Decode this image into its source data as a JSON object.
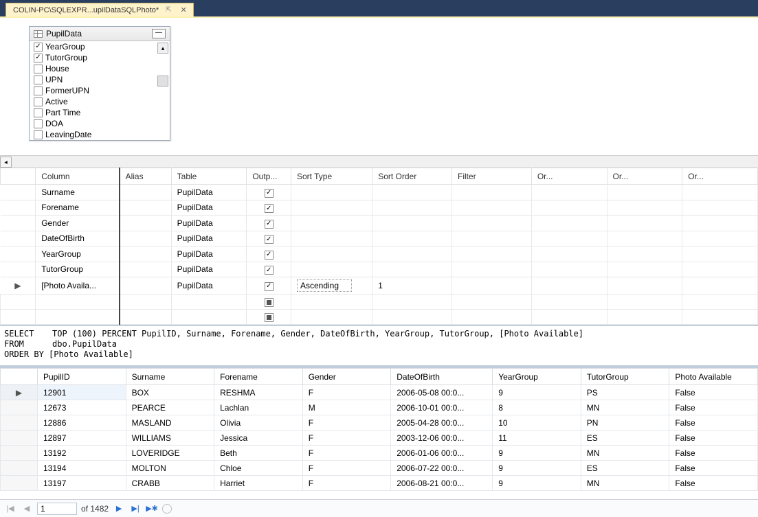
{
  "tab": {
    "title": "COLIN-PC\\SQLEXPR...upilDataSQLPhoto*",
    "pin": "⊕",
    "close": "✕"
  },
  "tableBox": {
    "title": "PupilData",
    "fields": [
      {
        "name": "YearGroup",
        "checked": true
      },
      {
        "name": "TutorGroup",
        "checked": true
      },
      {
        "name": "House",
        "checked": false
      },
      {
        "name": "UPN",
        "checked": false
      },
      {
        "name": "FormerUPN",
        "checked": false
      },
      {
        "name": "Active",
        "checked": false
      },
      {
        "name": "Part Time",
        "checked": false
      },
      {
        "name": "DOA",
        "checked": false
      },
      {
        "name": "LeavingDate",
        "checked": false
      }
    ]
  },
  "criteria": {
    "headers": [
      "",
      "Column",
      "Alias",
      "Table",
      "Outp...",
      "Sort Type",
      "Sort Order",
      "Filter",
      "Or...",
      "Or...",
      "Or..."
    ],
    "rows": [
      {
        "column": "Surname",
        "table": "PupilData",
        "output": true
      },
      {
        "column": "Forename",
        "table": "PupilData",
        "output": true
      },
      {
        "column": "Gender",
        "table": "PupilData",
        "output": true
      },
      {
        "column": "DateOfBirth",
        "table": "PupilData",
        "output": true
      },
      {
        "column": "YearGroup",
        "table": "PupilData",
        "output": true
      },
      {
        "column": "TutorGroup",
        "table": "PupilData",
        "output": true
      },
      {
        "column": "[Photo Availa...",
        "table": "PupilData",
        "output": true,
        "sortType": "Ascending",
        "sortOrder": "1",
        "selected": true
      }
    ]
  },
  "sql": {
    "line1a": "SELECT",
    "line1b": "TOP (100) PERCENT PupilID, Surname, Forename, Gender, DateOfBirth, YearGroup, TutorGroup, [Photo Available]",
    "line2a": "FROM",
    "line2b": "dbo.PupilData",
    "line3": "ORDER BY [Photo Available]"
  },
  "results": {
    "headers": [
      "",
      "PupilID",
      "Surname",
      "Forename",
      "Gender",
      "DateOfBirth",
      "YearGroup",
      "TutorGroup",
      "Photo Available"
    ],
    "rows": [
      {
        "sel": "▶",
        "PupilID": "12901",
        "Surname": "BOX",
        "Forename": "RESHMA",
        "Gender": "F",
        "DateOfBirth": "2006-05-08 00:0...",
        "YearGroup": "9",
        "TutorGroup": "PS",
        "PhotoAvailable": "False"
      },
      {
        "PupilID": "12673",
        "Surname": "PEARCE",
        "Forename": "Lachlan",
        "Gender": "M",
        "DateOfBirth": "2006-10-01 00:0...",
        "YearGroup": "8",
        "TutorGroup": "MN",
        "PhotoAvailable": "False"
      },
      {
        "PupilID": "12886",
        "Surname": "MASLAND",
        "Forename": "Olivia",
        "Gender": "F",
        "DateOfBirth": "2005-04-28 00:0...",
        "YearGroup": "10",
        "TutorGroup": "PN",
        "PhotoAvailable": "False"
      },
      {
        "PupilID": "12897",
        "Surname": "WILLIAMS",
        "Forename": "Jessica",
        "Gender": "F",
        "DateOfBirth": "2003-12-06 00:0...",
        "YearGroup": "11",
        "TutorGroup": "ES",
        "PhotoAvailable": "False"
      },
      {
        "PupilID": "13192",
        "Surname": "LOVERIDGE",
        "Forename": "Beth",
        "Gender": "F",
        "DateOfBirth": "2006-01-06 00:0...",
        "YearGroup": "9",
        "TutorGroup": "MN",
        "PhotoAvailable": "False"
      },
      {
        "PupilID": "13194",
        "Surname": "MOLTON",
        "Forename": "Chloe",
        "Gender": "F",
        "DateOfBirth": "2006-07-22 00:0...",
        "YearGroup": "9",
        "TutorGroup": "ES",
        "PhotoAvailable": "False"
      },
      {
        "PupilID": "13197",
        "Surname": "CRABB",
        "Forename": "Harriet",
        "Gender": "F",
        "DateOfBirth": "2006-08-21 00:0...",
        "YearGroup": "9",
        "TutorGroup": "MN",
        "PhotoAvailable": "False"
      }
    ]
  },
  "nav": {
    "current": "1",
    "of": "of 1482",
    "first": "|◀",
    "prev": "◀",
    "next": "▶",
    "last": "▶|",
    "new": "▶✱"
  }
}
